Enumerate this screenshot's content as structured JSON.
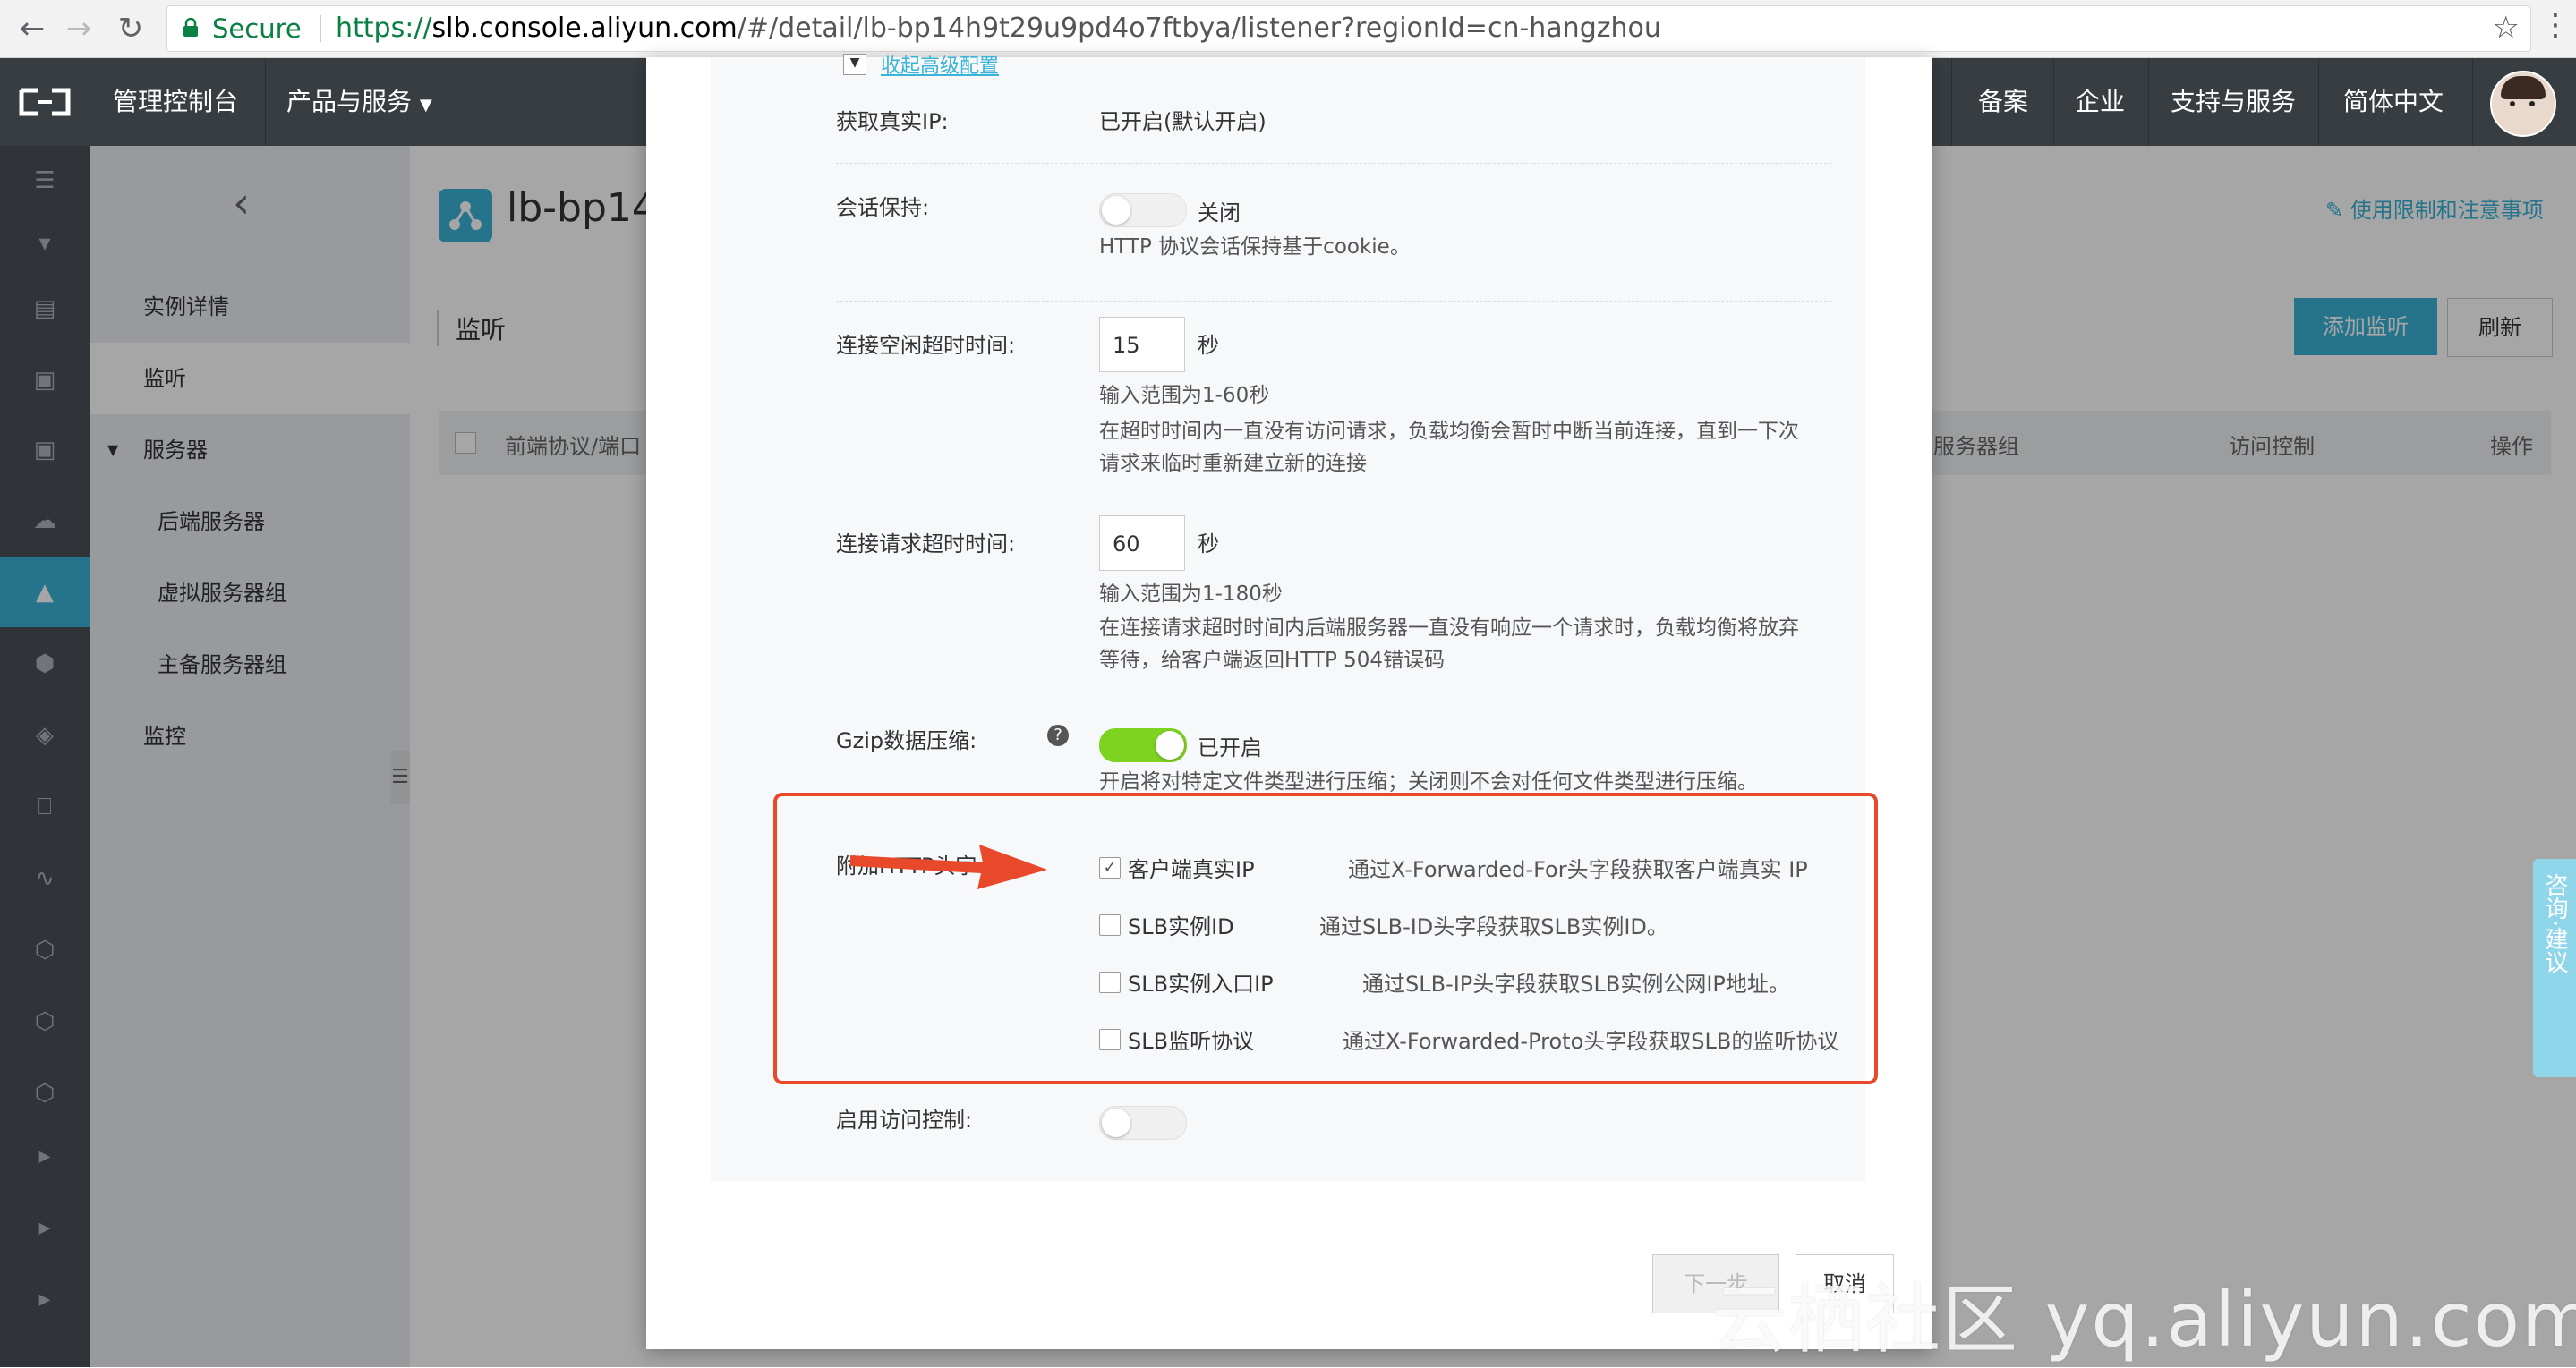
{
  "browser": {
    "secure_label": "Secure",
    "url_proto": "https://",
    "url_host": "slb.console.aliyun.com",
    "url_path": "/#/detail/lb-bp14h9t29u9pd4o7ftbya/listener?regionId=cn-hangzhou"
  },
  "topnav": {
    "console": "管理控制台",
    "products": "产品与服务",
    "items": [
      "备案",
      "企业",
      "支持与服务",
      "简体中文"
    ]
  },
  "sidebar": {
    "items": [
      {
        "label": "实例详情"
      },
      {
        "label": "监听"
      },
      {
        "label": "服务器"
      },
      {
        "label": "后端服务器"
      },
      {
        "label": "虚拟服务器组"
      },
      {
        "label": "主备服务器组"
      },
      {
        "label": "监控"
      }
    ]
  },
  "main": {
    "instance_title": "lb-bp14",
    "section": "监听",
    "usage_link": "使用限制和注意事项",
    "add_button": "添加监听",
    "refresh_button": "刷新",
    "table_headers": [
      "前端协议/端口",
      "服务器组",
      "访问控制",
      "操作"
    ]
  },
  "modal": {
    "collapse_link": "收起高级配置",
    "real_ip_label": "获取真实IP:",
    "real_ip_value": "已开启(默认开启)",
    "session_label": "会话保持:",
    "session_state": "关闭",
    "session_hint": "HTTP 协议会话保持基于cookie。",
    "idle_label": "连接空闲超时时间:",
    "idle_value": "15",
    "idle_unit": "秒",
    "idle_range": "输入范围为1-60秒",
    "idle_hint1": "在超时时间内一直没有访问请求，负载均衡会暂时中断当前连接，直到一下次",
    "idle_hint2": "请求来临时重新建立新的连接",
    "req_label": "连接请求超时时间:",
    "req_value": "60",
    "req_unit": "秒",
    "req_range": "输入范围为1-180秒",
    "req_hint1": "在连接请求超时时间内后端服务器一直没有响应一个请求时，负载均衡将放弃",
    "req_hint2": "等待，给客户端返回HTTP 504错误码",
    "gzip_label": "Gzip数据压缩:",
    "gzip_state": "已开启",
    "gzip_hint": "开启将对特定文件类型进行压缩；关闭则不会对任何文件类型进行压缩。",
    "headers_label": "附加HTTP头字",
    "options": [
      {
        "name": "客户端真实IP",
        "desc": "通过X-Forwarded-For头字段获取客户端真实 IP",
        "checked": true
      },
      {
        "name": "SLB实例ID",
        "desc": "通过SLB-ID头字段获取SLB实例ID。",
        "checked": false
      },
      {
        "name": "SLB实例入口IP",
        "desc": "通过SLB-IP头字段获取SLB实例公网IP地址。",
        "checked": false
      },
      {
        "name": "SLB监听协议",
        "desc": "通过X-Forwarded-Proto头字段获取SLB的监听协议",
        "checked": false
      }
    ],
    "acl_label": "启用访问控制:",
    "next_button": "下一步",
    "cancel_button": "取消"
  },
  "feedback_tab": "咨询·建议",
  "watermark": "云栖社区 yq.aliyun.com",
  "colors": {
    "accent": "#39b3d7",
    "switch_on": "#7ed321",
    "highlight": "#e8492b",
    "nav_bg": "#373d41"
  }
}
